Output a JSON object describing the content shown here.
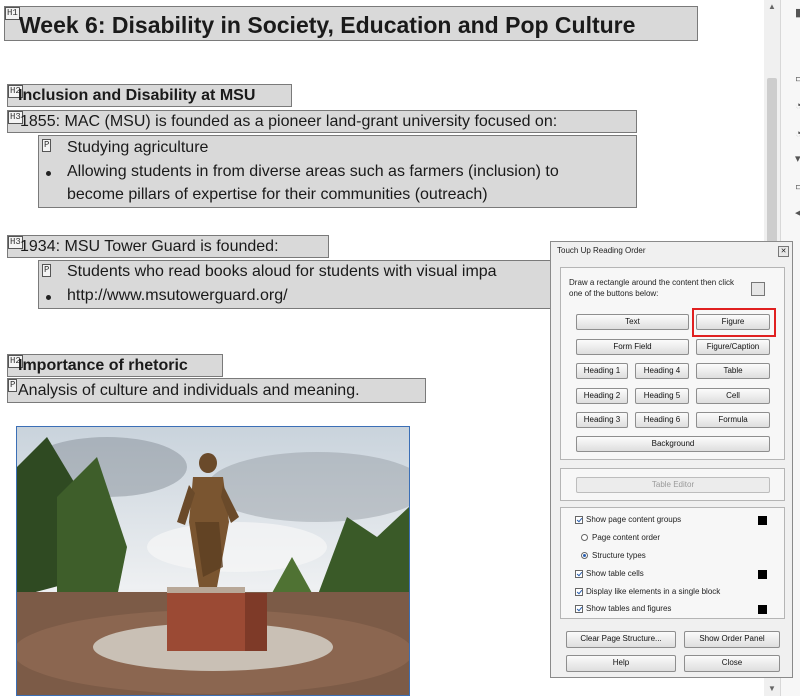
{
  "document": {
    "h1": {
      "tag": "H1",
      "text": "Week 6: Disability in Society, Education and Pop Culture"
    },
    "sections": [
      {
        "h2": {
          "tag": "H2",
          "text": "Inclusion and Disability at MSU"
        },
        "h3": {
          "tag": "H3",
          "text": "1855: MAC (MSU) is founded as a pioneer land-grant university focused on:"
        },
        "list": {
          "tag": "P",
          "items": [
            "Studying agriculture",
            "Allowing students in from diverse areas such as farmers (inclusion) to",
            "become pillars of expertise for their communities (outreach)"
          ]
        }
      },
      {
        "h3": {
          "tag": "H3",
          "text": "1934: MSU Tower Guard is founded:"
        },
        "list": {
          "tag": "P",
          "items": [
            "Students who read books aloud for students with visual impa",
            "http://www.msutowerguard.org/"
          ]
        }
      },
      {
        "h2": {
          "tag": "H2",
          "text": "Importance of rhetoric"
        },
        "p": {
          "tag": "P",
          "text": "Analysis of culture and individuals and meaning."
        }
      }
    ]
  },
  "dialog": {
    "title": "Touch Up Reading Order",
    "instruction_line1": "Draw a rectangle around the content then click",
    "instruction_line2": "one of the buttons below:",
    "buttons": {
      "text": "Text",
      "figure": "Figure",
      "form_field": "Form Field",
      "figure_caption": "Figure/Caption",
      "heading1": "Heading 1",
      "heading4": "Heading 4",
      "table": "Table",
      "heading2": "Heading 2",
      "heading5": "Heading 5",
      "cell": "Cell",
      "heading3": "Heading 3",
      "heading6": "Heading 6",
      "formula": "Formula",
      "background": "Background",
      "table_editor": "Table Editor",
      "clear_structure": "Clear Page Structure...",
      "show_order": "Show Order Panel",
      "help": "Help",
      "close": "Close"
    },
    "options": {
      "show_groups": "Show page content groups",
      "page_order": "Page content order",
      "structure_types": "Structure types",
      "show_cells": "Show table cells",
      "display_like": "Display like elements in a single block",
      "show_tables": "Show tables and figures"
    }
  },
  "colors": {
    "tag_fill": "#d9d9d9",
    "highlight": "#e02020",
    "swatch": "#000000"
  }
}
